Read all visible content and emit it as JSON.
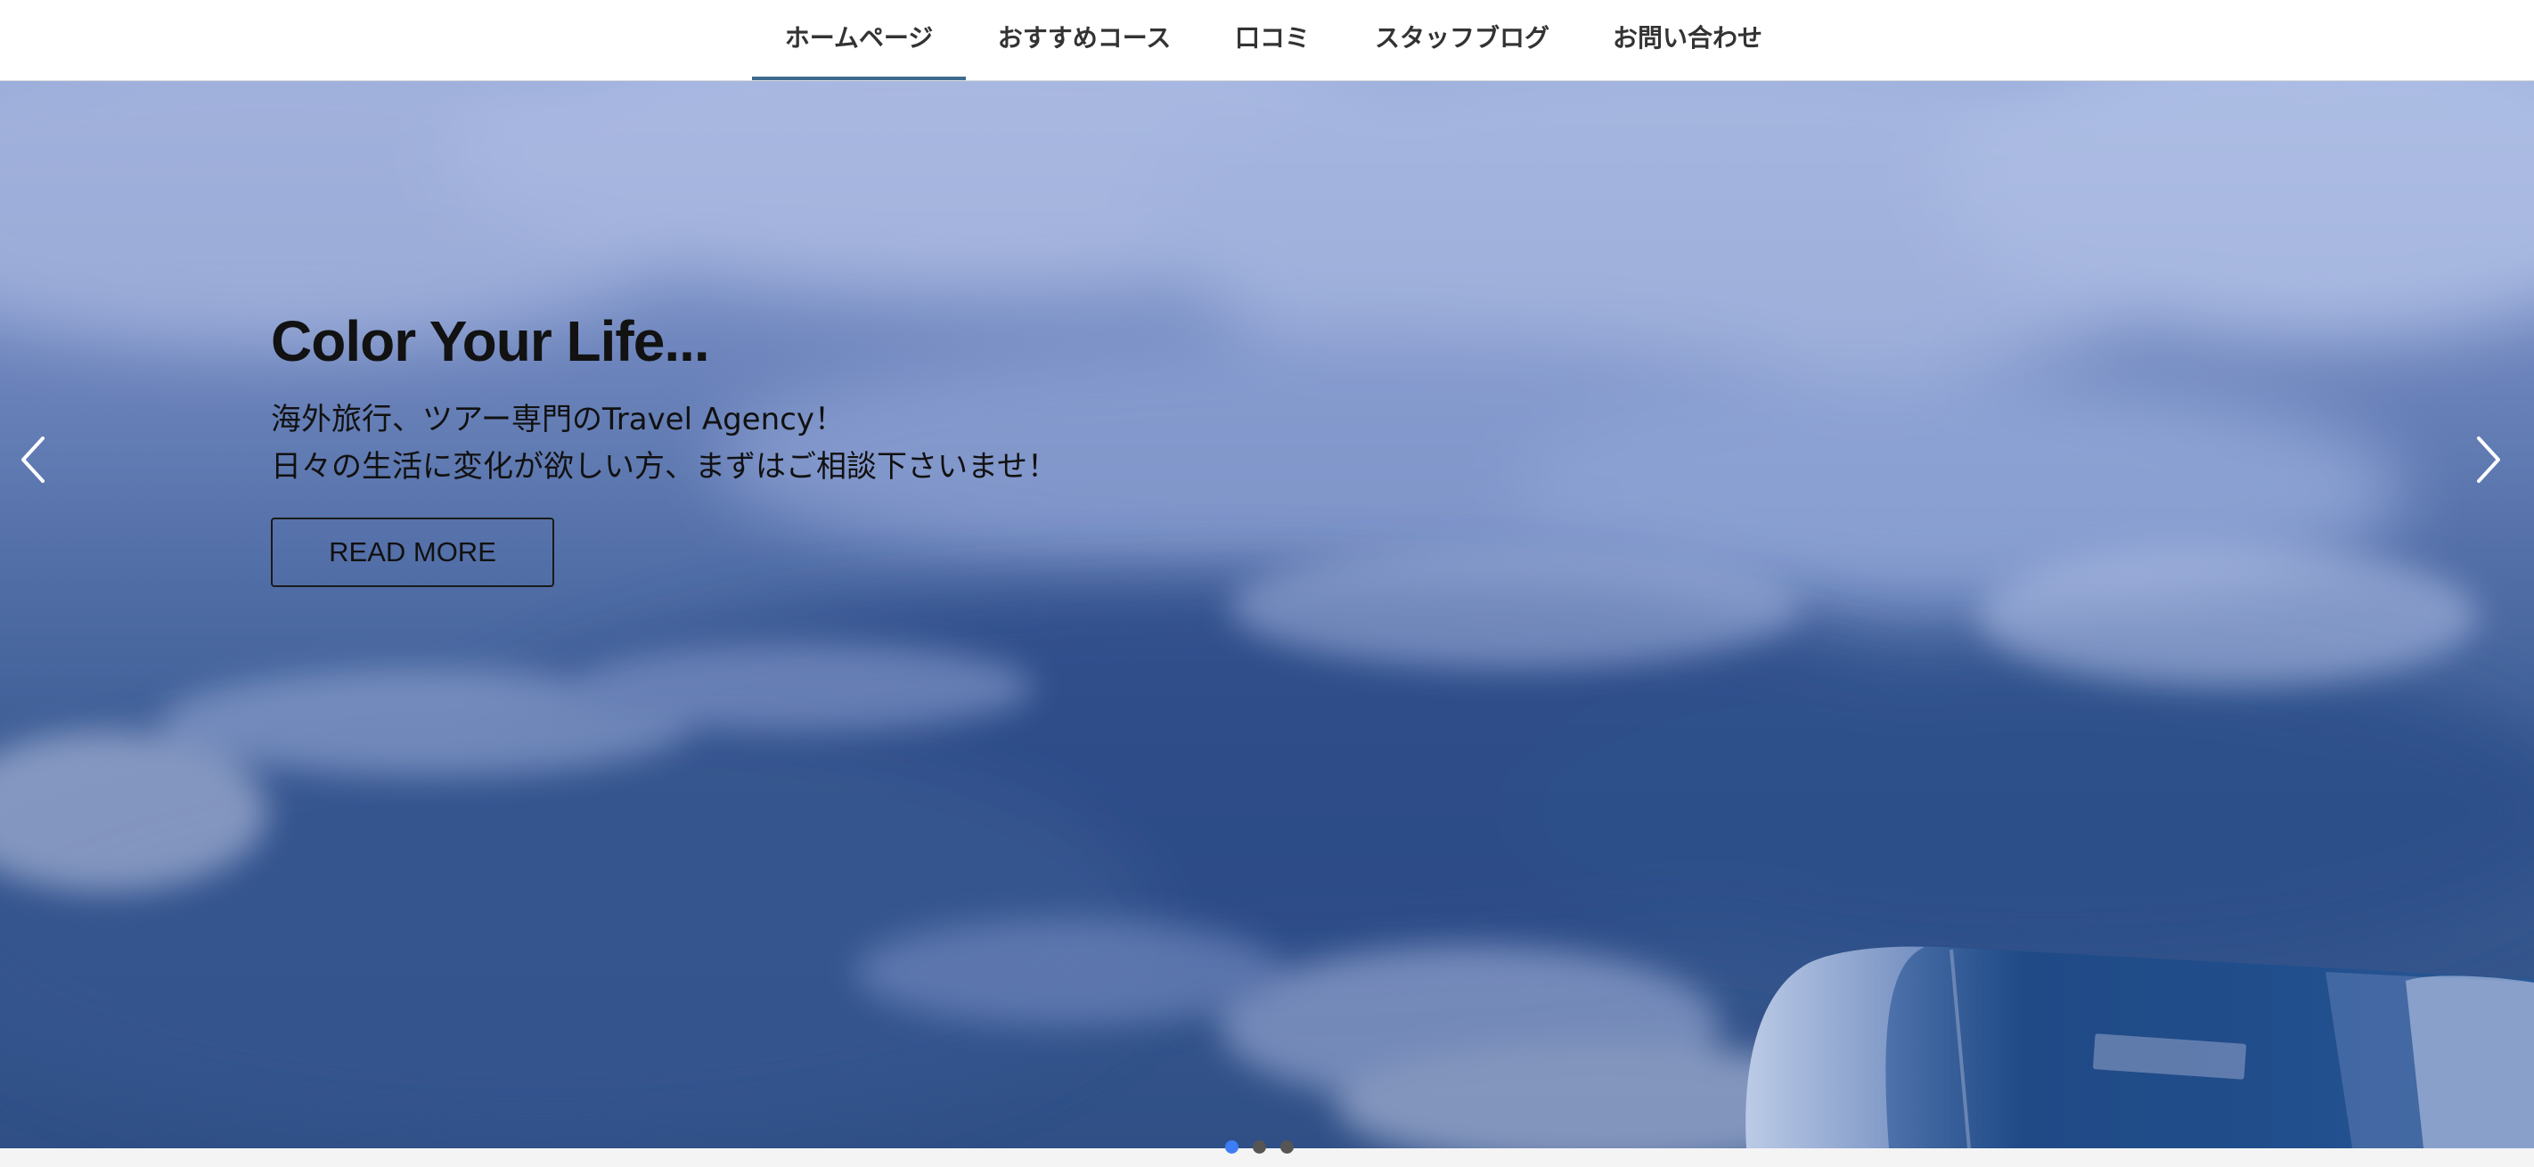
{
  "nav": {
    "items": [
      {
        "label": "ホームページ",
        "active": true
      },
      {
        "label": "おすすめコース",
        "active": false
      },
      {
        "label": "口コミ",
        "active": false
      },
      {
        "label": "スタッフブログ",
        "active": false
      },
      {
        "label": "お問い合わせ",
        "active": false
      }
    ],
    "active_color": "#3f6b8e"
  },
  "hero": {
    "title": "Color Your Life...",
    "line1": "海外旅行、ツアー専門のTravel Agency！",
    "line2": "日々の生活に変化が欲しい方、まずはご相談下さいませ！",
    "button_label": "READ MORE",
    "prev_icon": "chevron-left-icon",
    "next_icon": "chevron-right-icon"
  },
  "carousel": {
    "slide_count": 3,
    "active_index": 0,
    "active_dot_color": "#3d7df5",
    "inactive_dot_color": "#555555"
  }
}
